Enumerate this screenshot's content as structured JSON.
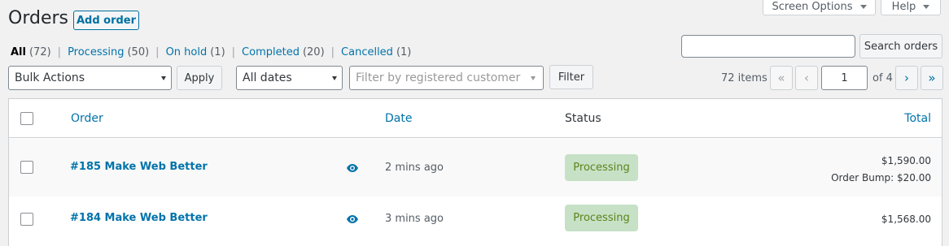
{
  "header": {
    "title": "Orders",
    "add_order_label": "Add order",
    "screen_options_label": "Screen Options",
    "help_label": "Help"
  },
  "filters": {
    "views": [
      {
        "label": "All",
        "count": "(72)"
      },
      {
        "label": "Processing",
        "count": "(50)"
      },
      {
        "label": "On hold",
        "count": "(1)"
      },
      {
        "label": "Completed",
        "count": "(20)"
      },
      {
        "label": "Cancelled",
        "count": "(1)"
      }
    ],
    "separator": "|"
  },
  "search": {
    "value": "",
    "button_label": "Search orders"
  },
  "toolbar": {
    "bulk_actions": "Bulk Actions",
    "apply_label": "Apply",
    "dates": "All dates",
    "customer_placeholder": "Filter by registered customer",
    "filter_label": "Filter"
  },
  "pagination": {
    "items_count": "72 items",
    "first": "«",
    "prev": "‹",
    "current_page": "1",
    "of_pages": "of 4",
    "next": "›",
    "last": "»"
  },
  "table": {
    "columns": {
      "order": "Order",
      "date": "Date",
      "status": "Status",
      "total": "Total"
    },
    "rows": [
      {
        "order": "#185 Make Web Better",
        "date": "2 mins ago",
        "status": "Processing",
        "total": "$1,590.00",
        "note": "Order Bump: $20.00"
      },
      {
        "order": "#184 Make Web Better",
        "date": "3 mins ago",
        "status": "Processing",
        "total": "$1,568.00"
      }
    ]
  },
  "icons": {
    "preview": "eye-icon"
  },
  "colors": {
    "link": "#0073aa",
    "status_processing_bg": "#c6e1c6",
    "status_processing_text": "#5b841b"
  }
}
